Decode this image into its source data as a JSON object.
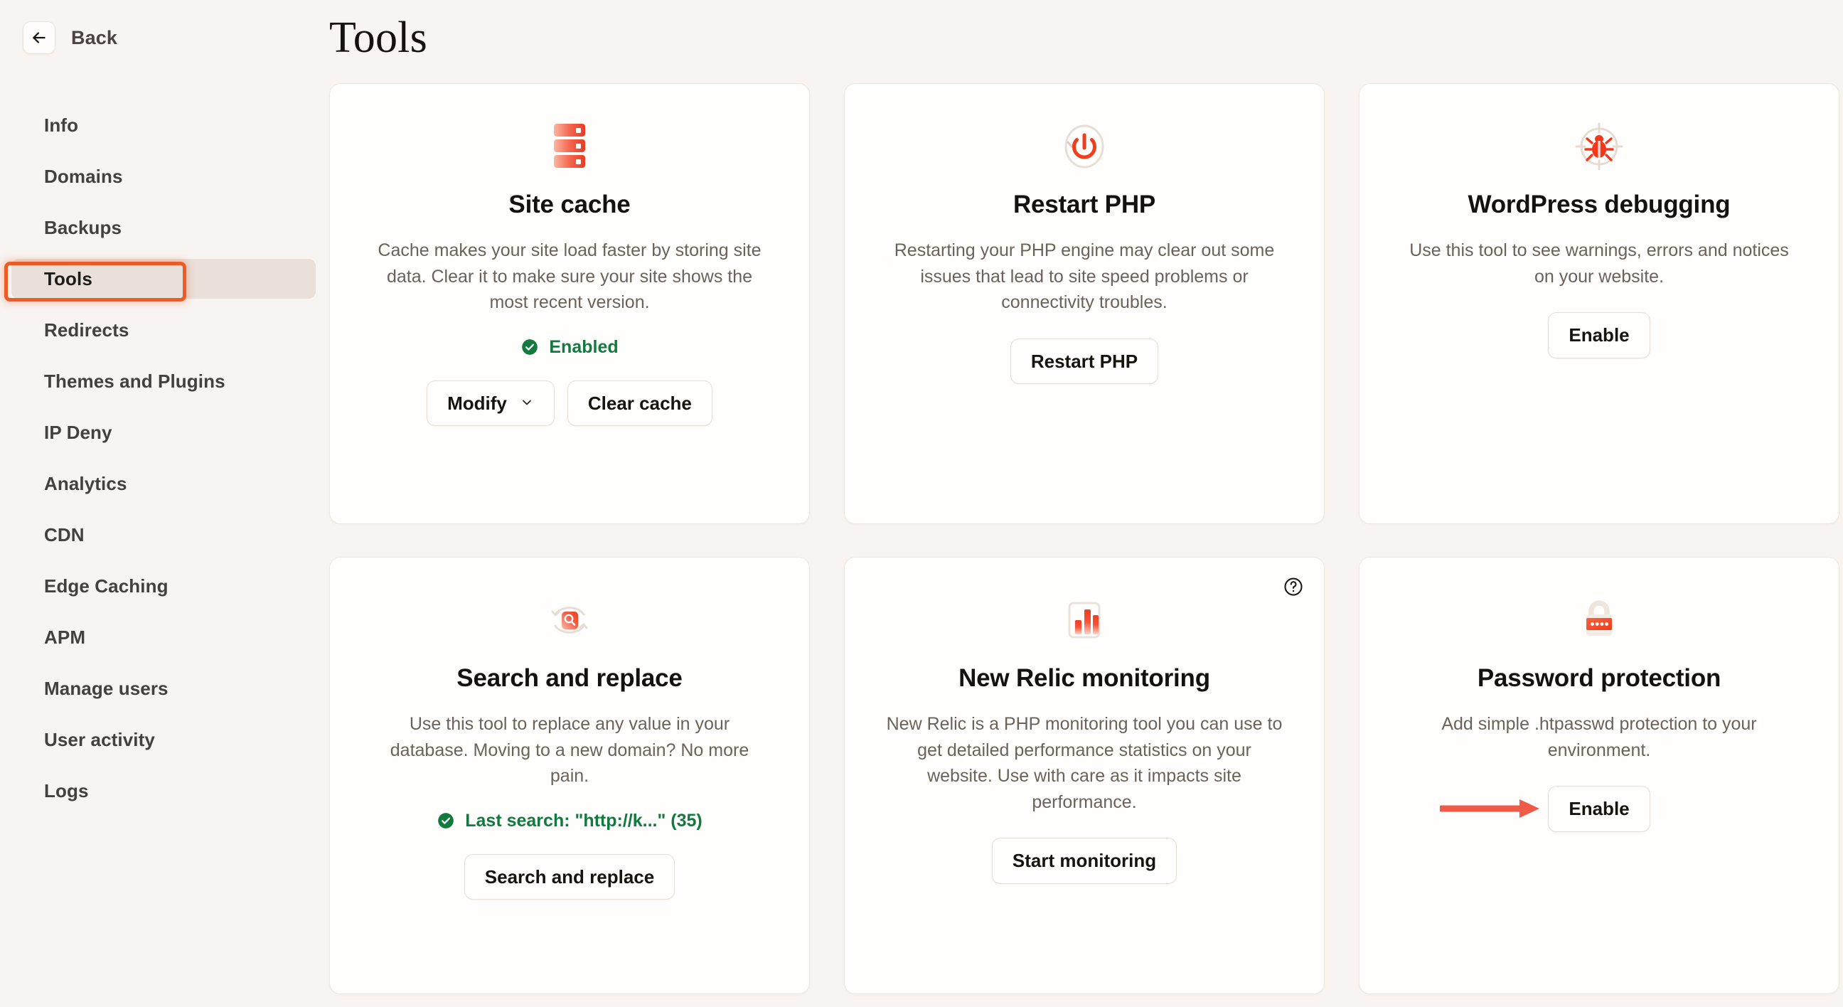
{
  "sidebar": {
    "back_label": "Back",
    "back_icon": "arrow-left-icon",
    "items": [
      {
        "label": "Info",
        "selected": false
      },
      {
        "label": "Domains",
        "selected": false
      },
      {
        "label": "Backups",
        "selected": false
      },
      {
        "label": "Tools",
        "selected": true
      },
      {
        "label": "Redirects",
        "selected": false
      },
      {
        "label": "Themes and Plugins",
        "selected": false
      },
      {
        "label": "IP Deny",
        "selected": false
      },
      {
        "label": "Analytics",
        "selected": false
      },
      {
        "label": "CDN",
        "selected": false
      },
      {
        "label": "Edge Caching",
        "selected": false
      },
      {
        "label": "APM",
        "selected": false
      },
      {
        "label": "Manage users",
        "selected": false
      },
      {
        "label": "User activity",
        "selected": false
      },
      {
        "label": "Logs",
        "selected": false
      }
    ]
  },
  "main": {
    "title": "Tools",
    "cards": [
      {
        "icon": "database-stack-icon",
        "title": "Site cache",
        "description": "Cache makes your site load faster by storing site data. Clear it to make sure your site shows the most recent version.",
        "status": "Enabled",
        "status_icon": "check-circle-icon",
        "primary_button": "Modify",
        "primary_button_icon": "chevron-down-icon",
        "secondary_button": "Clear cache"
      },
      {
        "icon": "power-restart-icon",
        "title": "Restart PHP",
        "description": "Restarting your PHP engine may clear out some issues that lead to site speed problems or connectivity troubles.",
        "primary_button": "Restart PHP"
      },
      {
        "icon": "bug-target-icon",
        "title": "WordPress debugging",
        "description": "Use this tool to see warnings, errors and notices on your website.",
        "primary_button": "Enable"
      },
      {
        "icon": "search-replace-icon",
        "title": "Search and replace",
        "description": "Use this tool to replace any value in your database. Moving to a new domain? No more pain.",
        "status": "Last search: \"http://k...\" (35)",
        "status_icon": "check-circle-icon",
        "primary_button": "Search and replace"
      },
      {
        "icon": "bar-chart-icon",
        "title": "New Relic monitoring",
        "description": "New Relic is a PHP monitoring tool you can use to get detailed performance statistics on your website. Use with care as it impacts site performance.",
        "primary_button": "Start monitoring",
        "help_icon": "help-circle-icon"
      },
      {
        "icon": "padlock-icon",
        "title": "Password protection",
        "description": "Add simple .htpasswd protection to your environment.",
        "primary_button": "Enable",
        "annotation_icon": "red-arrow-right-icon"
      }
    ]
  },
  "colors": {
    "page_background": "#f8f4f1",
    "card_background": "#fffefd",
    "accent_orange": "#ed5b27",
    "annotation_red": "#f05a47",
    "status_green": "#12793f",
    "selected_nav": "#e9e0d9"
  }
}
